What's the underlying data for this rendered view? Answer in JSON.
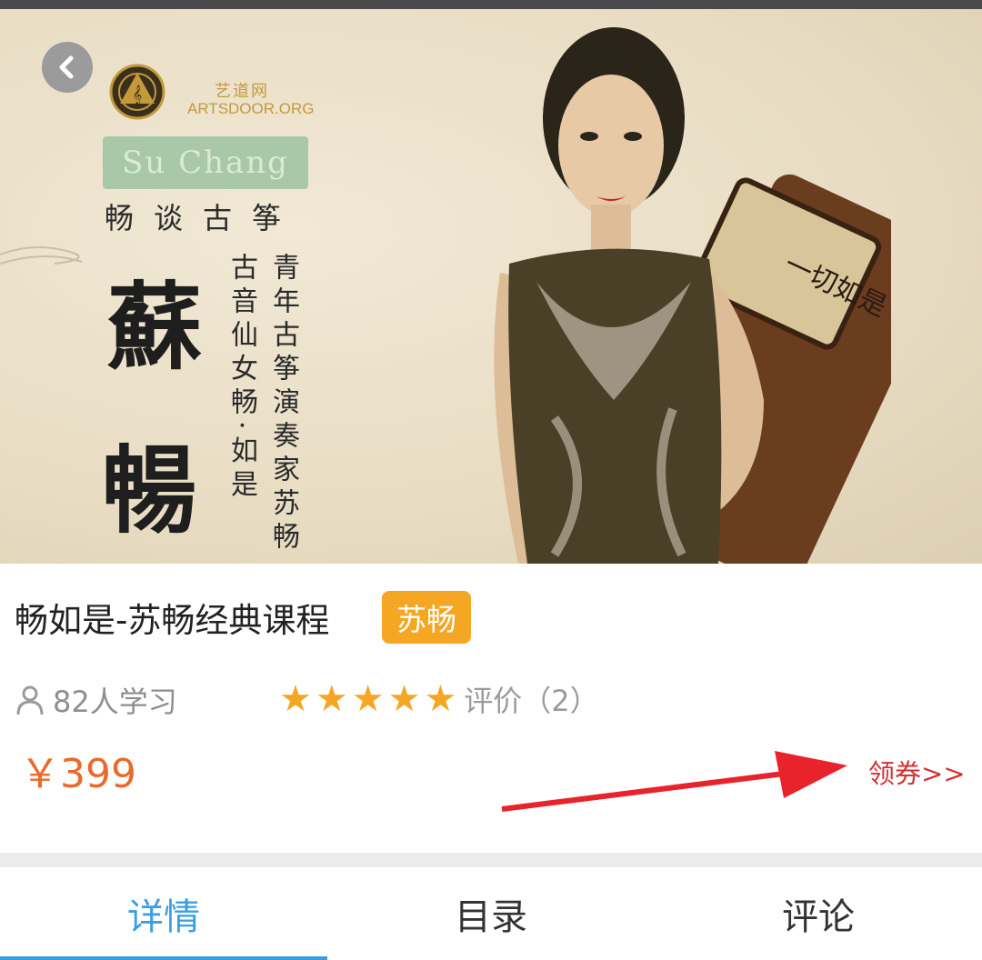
{
  "banner": {
    "logo_cn": "艺道网",
    "logo_en": "ARTSDOOR.ORG",
    "name_en": "Su Chang",
    "subtitle": "畅谈古筝",
    "big_char_1": "蘇",
    "big_char_2": "暢",
    "vertical_col_1": "古音仙女畅·如是",
    "vertical_col_2": "青年古筝演奏家苏畅"
  },
  "course": {
    "title": "畅如是-苏畅经典课程",
    "teacher_tag": "苏畅",
    "learners": "82人学习",
    "rating_stars": 5,
    "review_label": "评价（2）",
    "price": "￥399",
    "coupon": "领券>>"
  },
  "tabs": [
    {
      "label": "详情",
      "active": true
    },
    {
      "label": "目录",
      "active": false
    },
    {
      "label": "评论",
      "active": false
    }
  ],
  "colors": {
    "accent": "#3a9fe0",
    "price": "#e96a2b",
    "tag": "#f5a623",
    "coupon": "#d23131"
  }
}
